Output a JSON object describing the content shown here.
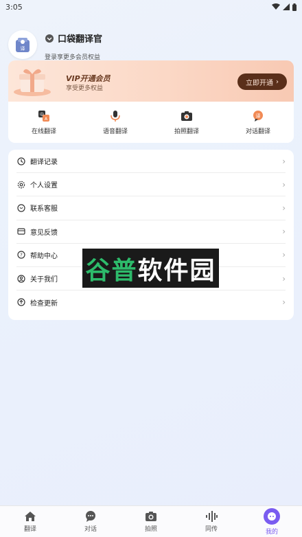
{
  "status_bar": {
    "time": "3:05"
  },
  "profile": {
    "app_name": "口袋翻译官",
    "login_hint": "登录享更多会员权益",
    "avatar_text": "译"
  },
  "vip": {
    "title": "VIP开通会员",
    "subtitle": "享受更多权益",
    "button_label": "立即开通"
  },
  "features": [
    {
      "label": "在线翻译",
      "icon": "online-translate-icon"
    },
    {
      "label": "语音翻译",
      "icon": "microphone-icon"
    },
    {
      "label": "拍照翻译",
      "icon": "camera-icon"
    },
    {
      "label": "对话翻译",
      "icon": "dialog-translate-icon"
    }
  ],
  "menu": [
    {
      "label": "翻译记录",
      "icon": "clock-icon"
    },
    {
      "label": "个人设置",
      "icon": "gear-icon"
    },
    {
      "label": "联系客服",
      "icon": "chat-icon"
    },
    {
      "label": "意见反馈",
      "icon": "feedback-icon"
    },
    {
      "label": "帮助中心",
      "icon": "help-icon"
    },
    {
      "label": "关于我们",
      "icon": "user-icon"
    },
    {
      "label": "检查更新",
      "icon": "update-icon"
    }
  ],
  "watermark": {
    "part_a": "谷普",
    "part_b": "软件园"
  },
  "tabs": [
    {
      "label": "翻译",
      "icon": "home-icon"
    },
    {
      "label": "对话",
      "icon": "dialog-icon"
    },
    {
      "label": "拍照",
      "icon": "camera-icon"
    },
    {
      "label": "同传",
      "icon": "waveform-icon"
    },
    {
      "label": "我的",
      "icon": "profile-icon",
      "active": true
    }
  ],
  "colors": {
    "accent": "#7a5cf0",
    "vip_button": "#5a2f1a",
    "watermark_green": "#2dbb6b"
  }
}
